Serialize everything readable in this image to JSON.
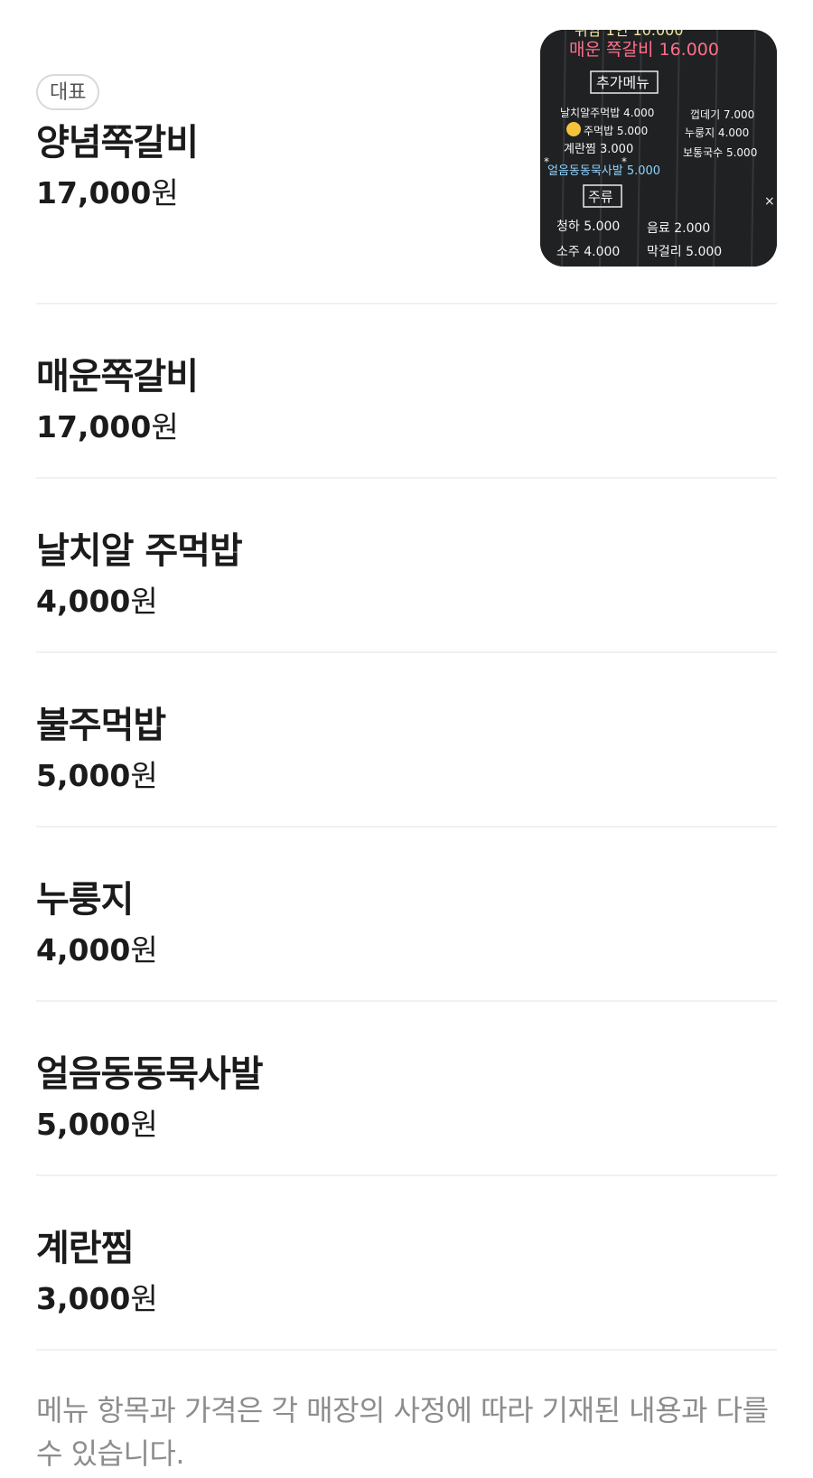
{
  "menu": {
    "items": [
      {
        "badge": "대표",
        "name": "양념쪽갈비",
        "price_number": "17,000",
        "price_unit": "원",
        "photo": {
          "description_icon": "chalkboard-menu-photo",
          "lines": [
            {
              "text": "매운 쪽갈비 16.000",
              "color": "#ff6f8a"
            },
            {
              "text": "추가메뉴",
              "color": "#f5f5f5"
            },
            {
              "text": "날치알주먹밥 4.000",
              "color": "#f5f5f5"
            },
            {
              "text": "주먹밥 5.000",
              "color": "#f5f5f5"
            },
            {
              "text": "계란찜 3.000",
              "color": "#f5f5f5"
            },
            {
              "text": "얼음동동묵사발 5.000",
              "color": "#8fd3ff"
            },
            {
              "text": "주류",
              "color": "#f5f5f5"
            },
            {
              "text": "청하 5.000",
              "color": "#f5f5f5"
            },
            {
              "text": "껍데기 7.000",
              "color": "#f5f5f5"
            },
            {
              "text": "누룽지 4.000",
              "color": "#f5f5f5"
            },
            {
              "text": "보통국수 5.000",
              "color": "#f5f5f5"
            },
            {
              "text": "음료 2.000",
              "color": "#f5f5f5"
            },
            {
              "text": "소주 4.000",
              "color": "#f5f5f5"
            },
            {
              "text": "막걸리 5.000",
              "color": "#f5f5f5"
            }
          ]
        }
      },
      {
        "name": "매운쪽갈비",
        "price_number": "17,000",
        "price_unit": "원"
      },
      {
        "name": "날치알 주먹밥",
        "price_number": "4,000",
        "price_unit": "원"
      },
      {
        "name": "불주먹밥",
        "price_number": "5,000",
        "price_unit": "원"
      },
      {
        "name": "누룽지",
        "price_number": "4,000",
        "price_unit": "원"
      },
      {
        "name": "얼음동동묵사발",
        "price_number": "5,000",
        "price_unit": "원"
      },
      {
        "name": "계란찜",
        "price_number": "3,000",
        "price_unit": "원"
      }
    ]
  },
  "notice": {
    "text": "메뉴 항목과 가격은 각 매장의 사정에 따라 기재된 내용과 다를 수 있습니다."
  },
  "colors": {
    "text_primary": "#1b1b1b",
    "text_secondary": "#8d8d8d",
    "divider": "#f1f1f1",
    "badge_border": "#d9d9d9",
    "chalkboard": "#1d1f21"
  }
}
